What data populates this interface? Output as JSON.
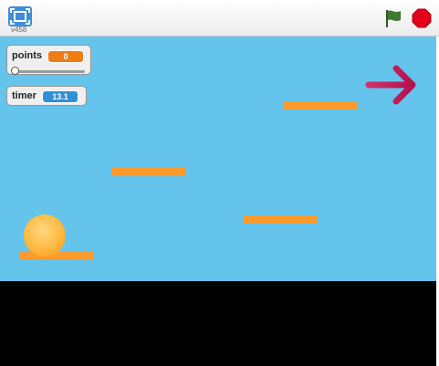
{
  "player": {
    "version": "v458",
    "icons": {
      "fullscreen": "fullscreen-icon",
      "green_flag": "green-flag-icon",
      "stop": "stop-icon"
    },
    "colors": {
      "stage_bg": "#64c4ec",
      "platform": "#ff9a2e",
      "ball": "#ffbf4a",
      "arrow": "#c2185b",
      "stop": "#e4001b",
      "flag": "#3d7a30"
    }
  },
  "monitors": {
    "points": {
      "label": "points",
      "value": "0",
      "slider_fraction": 0
    },
    "timer": {
      "label": "timer",
      "value": "13.1"
    }
  },
  "stage": {
    "arrow_icon": "right-arrow-icon"
  }
}
